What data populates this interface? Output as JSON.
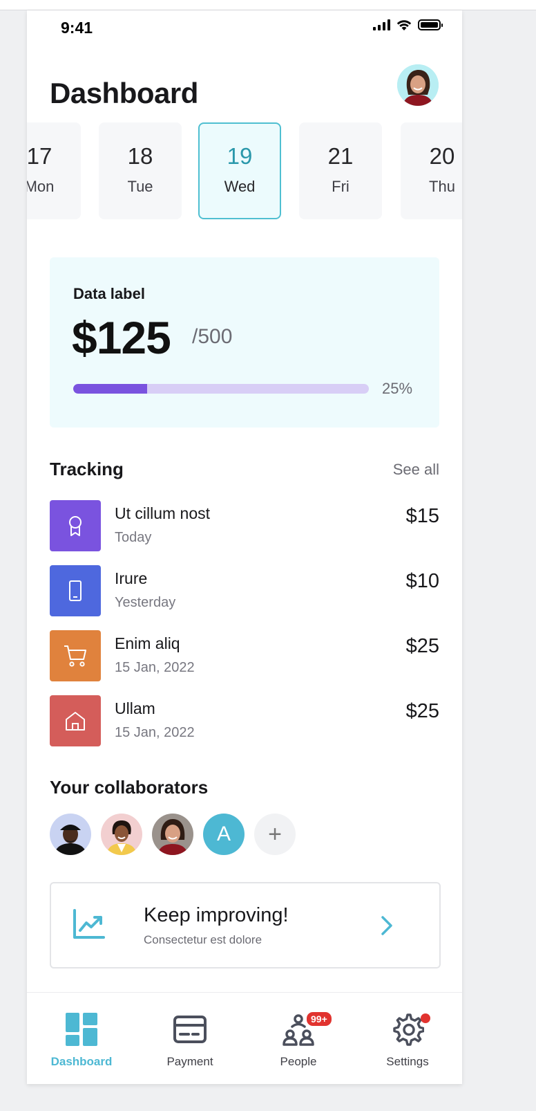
{
  "status_bar": {
    "time": "9:41"
  },
  "header": {
    "title": "Dashboard",
    "avatar_icon": "profile-avatar"
  },
  "dates": [
    {
      "num": "17",
      "day": "Mon",
      "selected": false
    },
    {
      "num": "18",
      "day": "Tue",
      "selected": false
    },
    {
      "num": "19",
      "day": "Wed",
      "selected": true
    },
    {
      "num": "21",
      "day": "Fri",
      "selected": false
    },
    {
      "num": "20",
      "day": "Thu",
      "selected": false
    }
  ],
  "data_card": {
    "label": "Data label",
    "value": "$125",
    "max": "/500",
    "progress_percent": "25%",
    "progress_fraction": 0.25,
    "colors": {
      "bg": "#eefbfd",
      "fill": "#7a53df",
      "track": "#d8cef6"
    }
  },
  "tracking": {
    "title": "Tracking",
    "see_all": "See all",
    "items": [
      {
        "title": "Ut cillum nost",
        "subtitle": "Today",
        "amount": "$15",
        "icon": "award-icon",
        "color": "#7a53df"
      },
      {
        "title": "Irure",
        "subtitle": "Yesterday",
        "amount": "$10",
        "icon": "phone-icon",
        "color": "#4e68de"
      },
      {
        "title": "Enim aliq",
        "subtitle": "15 Jan, 2022",
        "amount": "$25",
        "icon": "cart-icon",
        "color": "#e0823d"
      },
      {
        "title": "Ullam",
        "subtitle": "15 Jan, 2022",
        "amount": "$25",
        "icon": "home-icon",
        "color": "#d45d5a"
      }
    ]
  },
  "collaborators": {
    "title": "Your collaborators",
    "letter_avatar": "A",
    "add_symbol": "+"
  },
  "improve_card": {
    "title": "Keep improving!",
    "subtitle": "Consectetur est dolore",
    "icon": "trending-up-icon"
  },
  "bottom_nav": {
    "items": [
      {
        "label": "Dashboard",
        "icon": "dashboard-icon",
        "active": true
      },
      {
        "label": "Payment",
        "icon": "credit-card-icon",
        "active": false
      },
      {
        "label": "People",
        "icon": "people-icon",
        "active": false,
        "badge": "99+"
      },
      {
        "label": "Settings",
        "icon": "settings-icon",
        "active": false
      }
    ]
  },
  "accent_color": "#4db8d3"
}
